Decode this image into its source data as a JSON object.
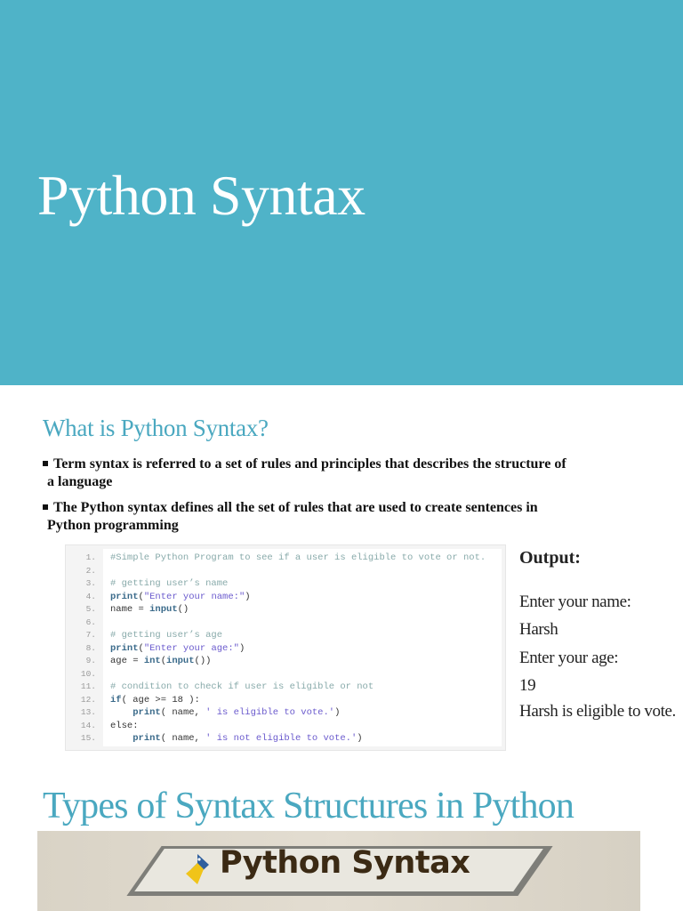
{
  "slide1": {
    "title": "Python Syntax"
  },
  "slide2": {
    "heading": "What is Python Syntax?",
    "bullets": [
      {
        "line1": "Term syntax is referred to a set of rules and principles that describes the structure of",
        "line2": "a language"
      },
      {
        "line1": "The Python syntax defines all the set of rules that are used to create sentences in",
        "line2": "Python programming"
      }
    ],
    "code": [
      {
        "n": "1.",
        "segs": [
          [
            "comment",
            "#Simple Python Program to see if a user is eligible to vote or not."
          ]
        ]
      },
      {
        "n": "2.",
        "segs": []
      },
      {
        "n": "3.",
        "segs": [
          [
            "comment",
            "# getting user’s name"
          ]
        ]
      },
      {
        "n": "4.",
        "segs": [
          [
            "kw",
            "print"
          ],
          [
            "plain",
            "("
          ],
          [
            "str",
            "\"Enter your name:\""
          ],
          [
            "plain",
            ")"
          ]
        ]
      },
      {
        "n": "5.",
        "segs": [
          [
            "plain",
            "name = "
          ],
          [
            "kw",
            "input"
          ],
          [
            "plain",
            "()"
          ]
        ]
      },
      {
        "n": "6.",
        "segs": []
      },
      {
        "n": "7.",
        "segs": [
          [
            "comment",
            "# getting user’s age"
          ]
        ]
      },
      {
        "n": "8.",
        "segs": [
          [
            "kw",
            "print"
          ],
          [
            "plain",
            "("
          ],
          [
            "str",
            "\"Enter your age:\""
          ],
          [
            "plain",
            ")"
          ]
        ]
      },
      {
        "n": "9.",
        "segs": [
          [
            "plain",
            "age = "
          ],
          [
            "kw",
            "int"
          ],
          [
            "plain",
            "("
          ],
          [
            "kw",
            "input"
          ],
          [
            "plain",
            "())"
          ]
        ]
      },
      {
        "n": "10.",
        "segs": []
      },
      {
        "n": "11.",
        "segs": [
          [
            "comment",
            "# condition to check if user is eligible or not"
          ]
        ]
      },
      {
        "n": "12.",
        "segs": [
          [
            "kw",
            "if"
          ],
          [
            "plain",
            "( age >= 18 ):"
          ]
        ]
      },
      {
        "n": "13.",
        "segs": [
          [
            "plain",
            "    "
          ],
          [
            "kw",
            "print"
          ],
          [
            "plain",
            "( name, "
          ],
          [
            "str",
            "' is eligible to vote.'"
          ],
          [
            "plain",
            ")"
          ]
        ]
      },
      {
        "n": "14.",
        "segs": [
          [
            "plain",
            "else:"
          ]
        ]
      },
      {
        "n": "15.",
        "segs": [
          [
            "plain",
            "    "
          ],
          [
            "kw",
            "print"
          ],
          [
            "plain",
            "( name, "
          ],
          [
            "str",
            "' is not eligible to vote.'"
          ],
          [
            "plain",
            ")"
          ]
        ]
      }
    ],
    "output": {
      "heading": "Output:",
      "lines": [
        "Enter your name:",
        "Harsh",
        "Enter your age:",
        "19",
        "Harsh is eligible to vote."
      ]
    }
  },
  "slide3": {
    "heading": "Types of Syntax Structures in Python",
    "image_text": "Python Syntax"
  },
  "colors": {
    "banner": "#4fb3c8",
    "heading": "#4aa8c0"
  }
}
